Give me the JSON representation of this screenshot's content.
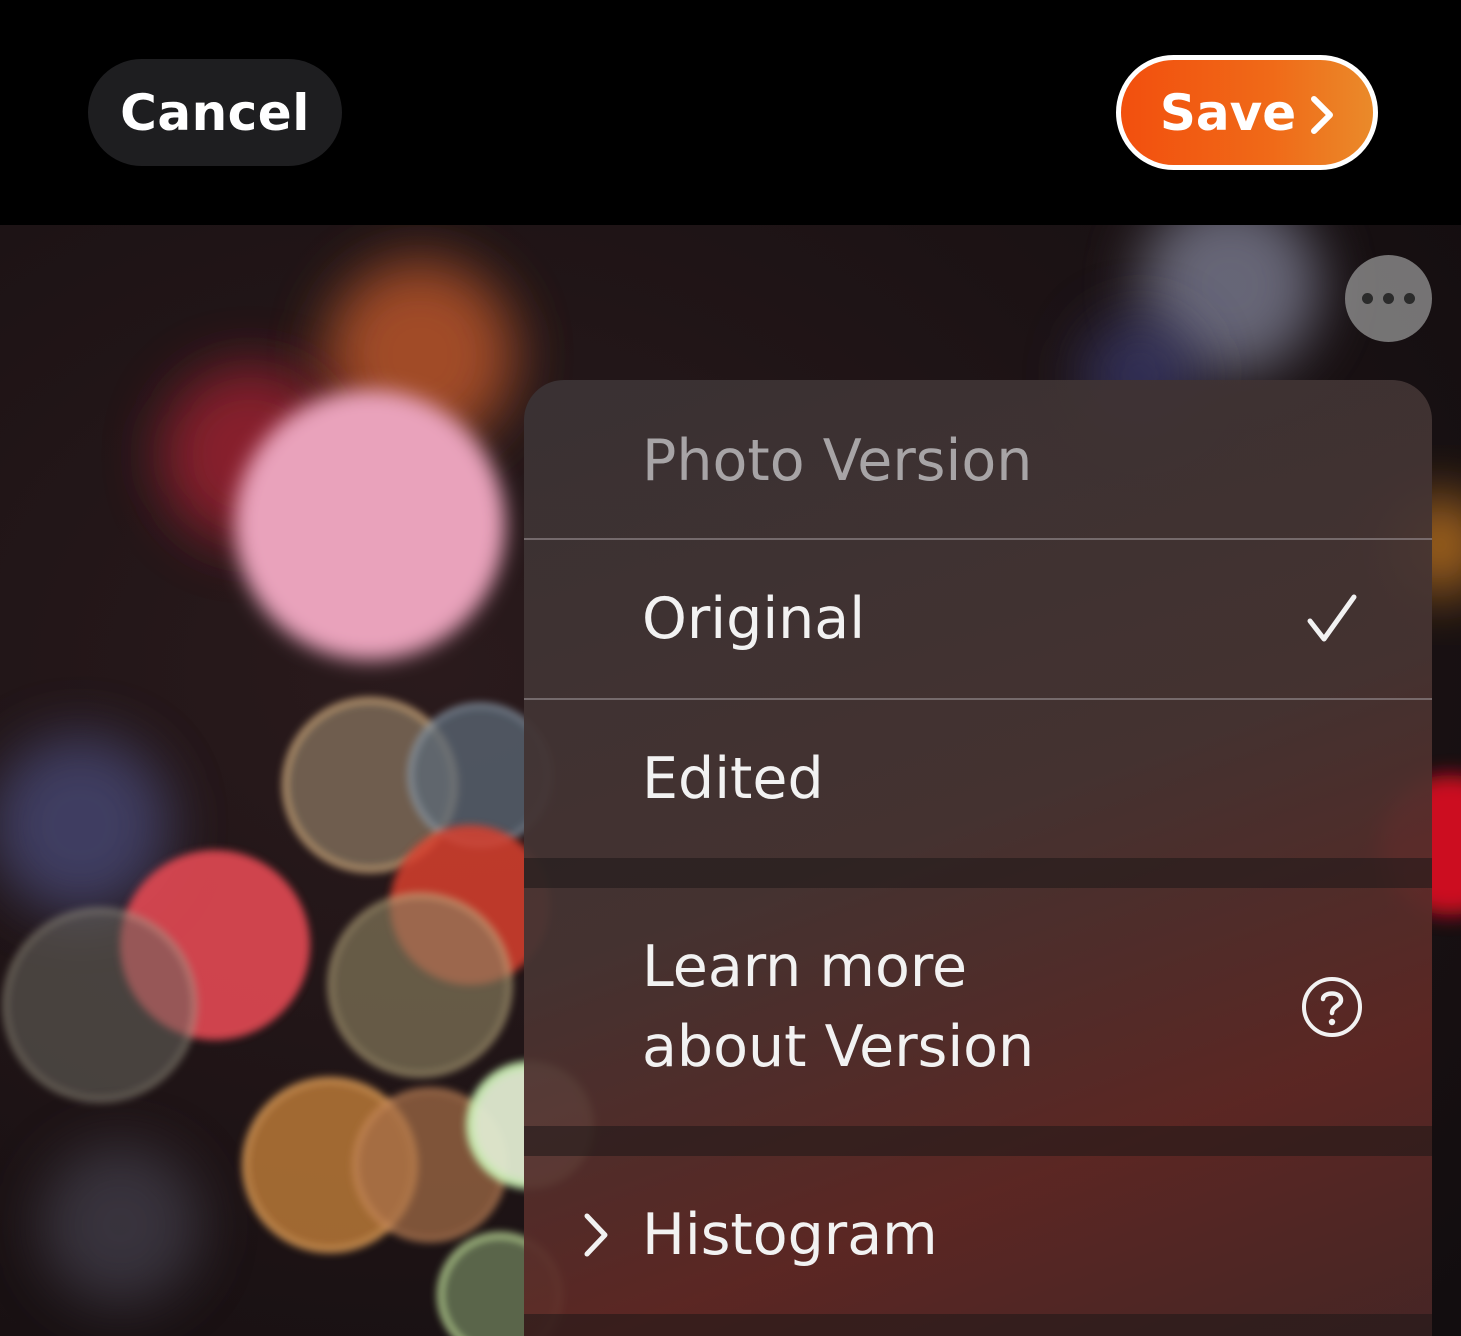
{
  "topbar": {
    "cancel_label": "Cancel",
    "save_label": "Save",
    "save_icon": "chevron-right-icon",
    "accent_color": "#f24f0e"
  },
  "photo": {
    "more_button_icon": "ellipsis-icon"
  },
  "menu": {
    "header": "Photo Version",
    "items": [
      {
        "label": "Original",
        "selected": true,
        "icon": "checkmark-icon"
      },
      {
        "label": "Edited",
        "selected": false
      }
    ],
    "learn_more": {
      "line1": "Learn more",
      "line2": "about Version",
      "icon": "question-circle-icon"
    },
    "histogram": {
      "label": "Histogram",
      "icon": "chevron-right-icon"
    }
  }
}
